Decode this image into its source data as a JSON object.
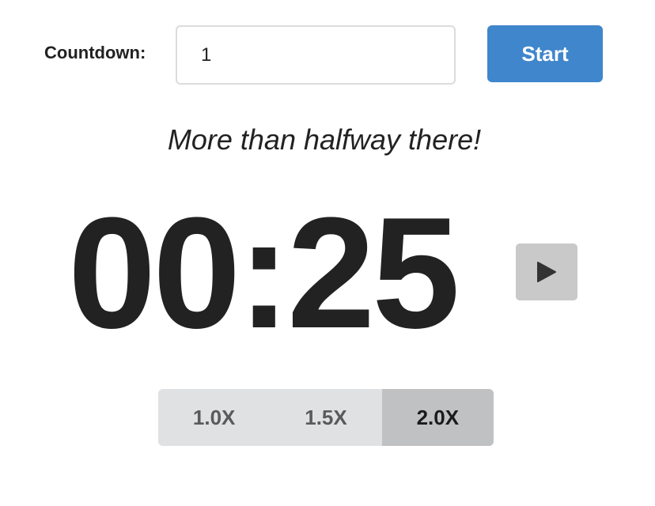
{
  "countdown": {
    "label": "Countdown:",
    "value": "1",
    "placeholder": ""
  },
  "start_button": {
    "label": "Start"
  },
  "status_message": "More than halfway there!",
  "timer": {
    "display": "00:25"
  },
  "play_button": {
    "icon": "play-icon"
  },
  "speed_options": [
    {
      "label": "1.0X",
      "active": false
    },
    {
      "label": "1.5X",
      "active": false
    },
    {
      "label": "2.0X",
      "active": true
    }
  ],
  "colors": {
    "accent": "#3f86cc",
    "text": "#222222",
    "speed_inactive_bg": "#e0e1e2",
    "speed_active_bg": "#c0c1c2",
    "play_button_bg": "#c9c9c9"
  }
}
